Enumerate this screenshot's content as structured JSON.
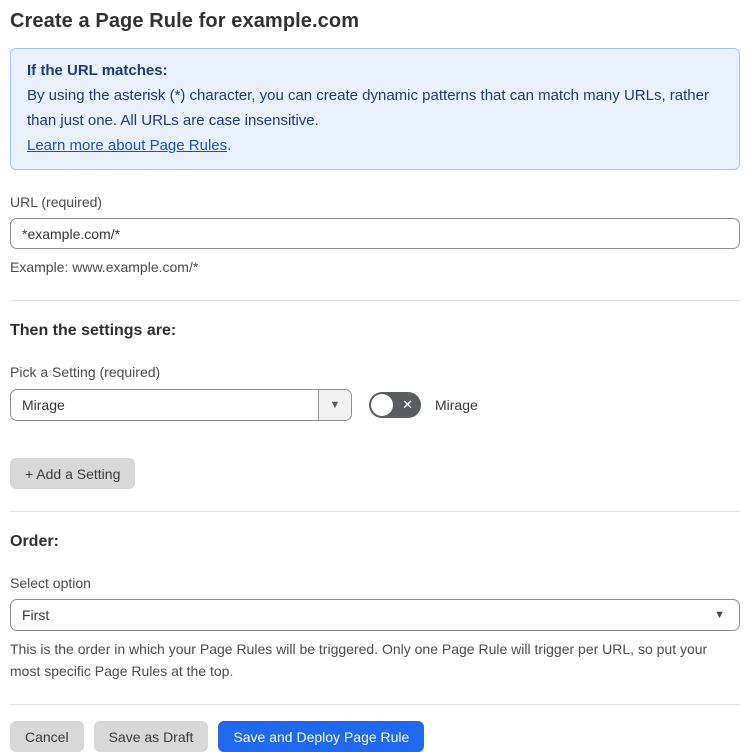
{
  "page": {
    "title": "Create a Page Rule for example.com"
  },
  "info_box": {
    "heading": "If the URL matches:",
    "body": "By using the asterisk (*) character, you can create dynamic patterns that can match many URLs, rather than just one. All URLs are case insensitive.",
    "link_label": "Learn more about Page Rules",
    "link_suffix": "."
  },
  "url_field": {
    "label": "URL (required)",
    "value": "*example.com/*",
    "helper": "Example: www.example.com/*"
  },
  "settings": {
    "heading": "Then the settings are:",
    "picker_label": "Pick a Setting (required)",
    "selected_setting": "Mirage",
    "toggle_label": "Mirage",
    "toggle_state": "off",
    "add_button_label": "+ Add a Setting"
  },
  "order": {
    "heading": "Order:",
    "label": "Select option",
    "selected_option": "First",
    "helper": "This is the order in which your Page Rules will be triggered. Only one Page Rule will trigger per URL, so put your most specific Page Rules at the top."
  },
  "footer": {
    "cancel_label": "Cancel",
    "save_draft_label": "Save as Draft",
    "save_deploy_label": "Save and Deploy Page Rule"
  },
  "icons": {
    "dropdown_arrow": "▼",
    "x_mark": "✕"
  },
  "colors": {
    "info_bg": "#e9f2fc",
    "info_border": "#9cc6ee",
    "info_text": "#1e3c74",
    "link": "#1d4fc4",
    "primary_button": "#2068f0",
    "secondary_button": "#d8d8d8",
    "toggle_off": "#595d62"
  }
}
